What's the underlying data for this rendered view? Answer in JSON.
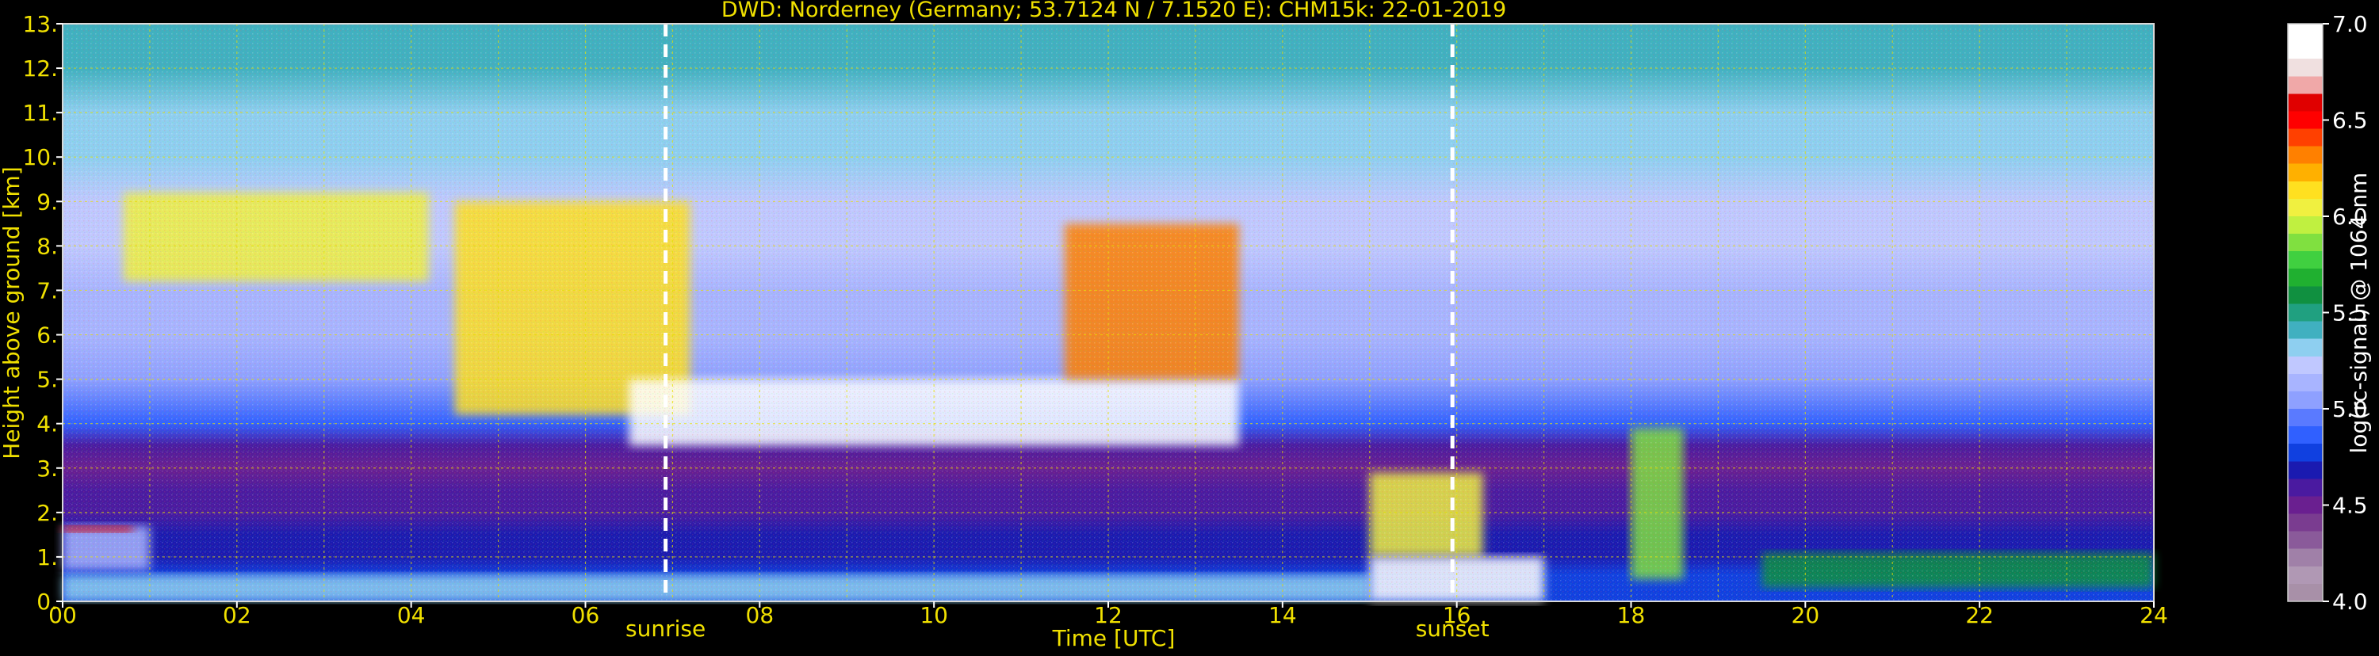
{
  "chart_data": {
    "type": "heatmap",
    "title": "DWD: Norderney (Germany; 53.7124 N / 7.1520 E):    CHM15k: 22-01-2019",
    "xlabel": "Time [UTC]",
    "ylabel": "Height above ground [km]",
    "xlim": [
      0,
      24
    ],
    "ylim": [
      0,
      13
    ],
    "x_ticks": [
      "00",
      "02",
      "04",
      "06",
      "08",
      "10",
      "12",
      "14",
      "16",
      "18",
      "20",
      "22",
      "24"
    ],
    "x_tick_values": [
      0,
      2,
      4,
      6,
      8,
      10,
      12,
      14,
      16,
      18,
      20,
      22,
      24
    ],
    "y_ticks": [
      "0.",
      "1.",
      "2.",
      "3.",
      "4.",
      "5.",
      "6.",
      "7.",
      "8.",
      "9.",
      "10.",
      "11.",
      "12.",
      "13."
    ],
    "y_tick_values": [
      0,
      1,
      2,
      3,
      4,
      5,
      6,
      7,
      8,
      9,
      10,
      11,
      12,
      13
    ],
    "grid": true,
    "markers": [
      {
        "label": "sunrise",
        "time": 6.92
      },
      {
        "label": "sunset",
        "time": 15.95
      }
    ],
    "colorbar": {
      "label": "log(rc-signal) @ 1064 nm",
      "range": [
        4.0,
        7.0
      ],
      "ticks": [
        "4.0",
        "4.5",
        "5.0",
        "5.5",
        "6.0",
        "6.5",
        "7.0"
      ],
      "tick_values": [
        4.0,
        4.5,
        5.0,
        5.5,
        6.0,
        6.5,
        7.0
      ],
      "colors": [
        "#a890a8",
        "#b098b4",
        "#a080a8",
        "#8a5a9a",
        "#7a3c90",
        "#6a1f90",
        "#4a1aa0",
        "#1a1ab0",
        "#1040e0",
        "#3060ff",
        "#5a7aff",
        "#8ea0ff",
        "#a8b4ff",
        "#c0c8ff",
        "#8ecff0",
        "#40b0c0",
        "#20a080",
        "#109040",
        "#20b030",
        "#40d040",
        "#80e040",
        "#c0f040",
        "#f0f040",
        "#ffe020",
        "#ffb000",
        "#ff8000",
        "#ff4000",
        "#ff0000",
        "#e00000",
        "#f0a8a8",
        "#f0e0e0",
        "#ffffff",
        "#ffffff"
      ]
    },
    "background_profile": {
      "heights_km": [
        0.2,
        0.6,
        1.0,
        1.5,
        2.0,
        2.5,
        3.0,
        3.5,
        4.0,
        5.0,
        6.0,
        7.0,
        8.0,
        9.0,
        10.0,
        11.0,
        12.0,
        13.0
      ],
      "values": [
        4.8,
        4.75,
        4.7,
        4.65,
        4.6,
        4.55,
        4.5,
        4.55,
        4.9,
        5.0,
        5.1,
        5.15,
        5.2,
        5.25,
        5.3,
        5.35,
        5.4,
        5.45
      ]
    },
    "features": [
      {
        "name": "low-aerosol-layer",
        "t_start": 0.0,
        "t_end": 15.0,
        "h_bottom": 0.0,
        "h_top": 0.6,
        "value": 5.3
      },
      {
        "name": "early-boundary-layer",
        "t_start": 0.0,
        "t_end": 1.0,
        "h_bottom": 0.7,
        "h_top": 1.7,
        "value": 5.1
      },
      {
        "name": "early-cloud-top",
        "t_start": 0.0,
        "t_end": 0.8,
        "h_bottom": 1.55,
        "h_top": 1.7,
        "value": 6.6
      },
      {
        "name": "mid-level-cloud",
        "t_start": 4.5,
        "t_end": 7.2,
        "h_bottom": 4.2,
        "h_top": 9.0,
        "value": 6.1
      },
      {
        "name": "mid-level-cloud-core",
        "t_start": 6.5,
        "t_end": 13.5,
        "h_bottom": 3.5,
        "h_top": 5.0,
        "value": 6.9
      },
      {
        "name": "upper-virga",
        "t_start": 11.5,
        "t_end": 13.5,
        "h_bottom": 5.0,
        "h_top": 8.5,
        "value": 6.3
      },
      {
        "name": "high-cirrus-patches",
        "t_start": 0.7,
        "t_end": 4.2,
        "h_bottom": 7.2,
        "h_top": 9.2,
        "value": 6.0
      },
      {
        "name": "convective-tops",
        "t_start": 15.0,
        "t_end": 16.3,
        "h_bottom": 1.0,
        "h_top": 2.9,
        "value": 6.0
      },
      {
        "name": "evening-low-cloud",
        "t_start": 15.0,
        "t_end": 17.0,
        "h_bottom": 0.0,
        "h_top": 1.0,
        "value": 6.9
      },
      {
        "name": "showers-18h",
        "t_start": 18.0,
        "t_end": 18.6,
        "h_bottom": 0.5,
        "h_top": 3.9,
        "value": 5.9
      },
      {
        "name": "night-boundary-layer",
        "t_start": 19.5,
        "t_end": 24.0,
        "h_bottom": 0.3,
        "h_top": 1.1,
        "value": 5.6
      }
    ]
  }
}
